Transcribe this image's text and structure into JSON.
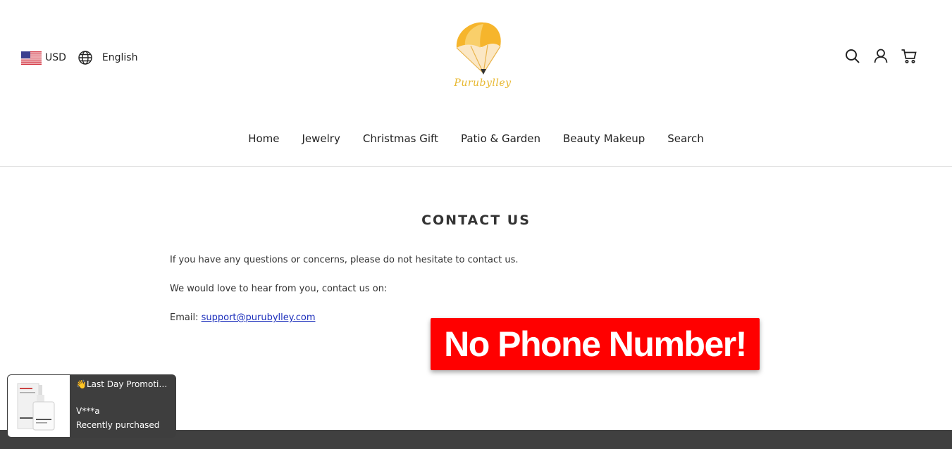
{
  "header": {
    "currency": "USD",
    "language": "English",
    "logo_text": "Purubylley"
  },
  "nav": {
    "items": [
      "Home",
      "Jewelry",
      "Christmas Gift",
      "Patio & Garden",
      "Beauty Makeup",
      "Search"
    ]
  },
  "icons": {
    "flag": "us-flag-icon",
    "language": "globe-icon",
    "search": "search-icon",
    "account": "user-icon",
    "cart": "cart-icon"
  },
  "page": {
    "title": "CONTACT US",
    "paragraph_1": "If you have any questions or concerns, please do not hesitate to contact us.",
    "paragraph_2": "We would love to hear from you, contact us on:",
    "email_label": "Email: ",
    "email": "support@purubylley.com"
  },
  "annotation": {
    "text": "No Phone Number!",
    "color": "#ff0000"
  },
  "popup": {
    "title": "👋Last Day Promotion...",
    "buyer": "V***a",
    "status": "Recently purchased"
  },
  "colors": {
    "logo_yellow": "#f5b82e",
    "link": "#1a2dbb",
    "footer": "#404040",
    "popup_bg": "#3e3e3e"
  }
}
